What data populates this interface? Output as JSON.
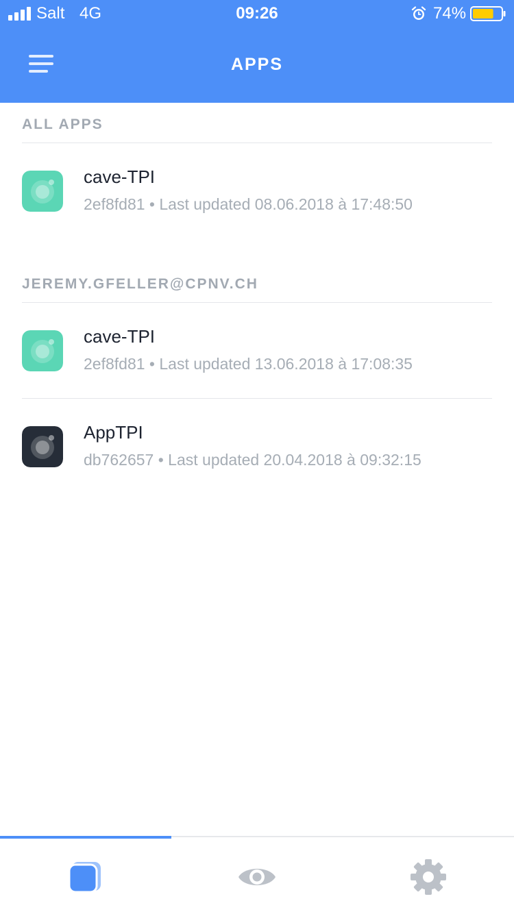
{
  "status_bar": {
    "carrier": "Salt",
    "network": "4G",
    "time": "09:26",
    "battery_percent": "74%",
    "battery_level": 0.74,
    "battery_color": "#ffcc00",
    "icons": [
      "signal-icon",
      "alarm-icon",
      "battery-icon"
    ]
  },
  "header": {
    "title": "APPS",
    "menu_icon": "menu-icon",
    "background": "#4d8ff8"
  },
  "sections": [
    {
      "title": "ALL APPS",
      "apps": [
        {
          "name": "cave-TPI",
          "meta": "2ef8fd81 • Last updated 08.06.2018 à 17:48:50",
          "icon_color": "#5bd6b5"
        }
      ]
    },
    {
      "title": "JEREMY.GFELLER@CPNV.CH",
      "apps": [
        {
          "name": "cave-TPI",
          "meta": "2ef8fd81 • Last updated 13.06.2018 à 17:08:35",
          "icon_color": "#5bd6b5"
        },
        {
          "name": "AppTPI",
          "meta": "db762657 • Last updated 20.04.2018 à 09:32:15",
          "icon_color": "#262d38"
        }
      ]
    }
  ],
  "tab_bar": {
    "tabs": [
      {
        "icon": "apps-icon",
        "active": true
      },
      {
        "icon": "eye-icon",
        "active": false
      },
      {
        "icon": "gear-icon",
        "active": false
      }
    ],
    "active_color": "#4d8ff8",
    "inactive_color": "#bcc1c8"
  }
}
